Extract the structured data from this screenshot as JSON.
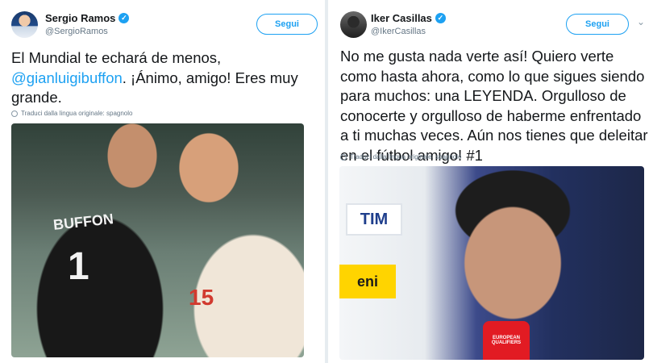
{
  "left_tweet": {
    "display_name": "Sergio Ramos",
    "handle": "@SergioRamos",
    "follow_label": "Segui",
    "text_before": "El Mundial te echará de menos, ",
    "mention": "@gianluigibuffon",
    "text_after": ". ¡Ánimo, amigo! Eres muy grande.",
    "translate_label": "Traduci dalla lingua originale: spagnolo",
    "photo": {
      "jersey_name": "BUFFON",
      "jersey_number": "1",
      "other_number": "15"
    }
  },
  "right_tweet": {
    "display_name": "Iker Casillas",
    "handle": "@IkerCasillas",
    "follow_label": "Segui",
    "chevron": "⌄",
    "text": "No me gusta nada verte así! Quiero verte como hasta ahora, como lo que sigues siendo para muchos: una LEYENDA. Orgulloso de conocerte y orgulloso de haberme enfrentado a ti muchas veces. Aún nos tienes que deleitar en el fútbol amigo! #1",
    "translate_label": "Traduci dalla lingua originale: spagnolo",
    "photo": {
      "sponsor_1": "TIM",
      "sponsor_2": "eni",
      "mic_label": "EUROPEAN QUALIFIERS"
    }
  },
  "colors": {
    "accent": "#1da1f2",
    "text": "#14171a",
    "muted": "#657786"
  }
}
